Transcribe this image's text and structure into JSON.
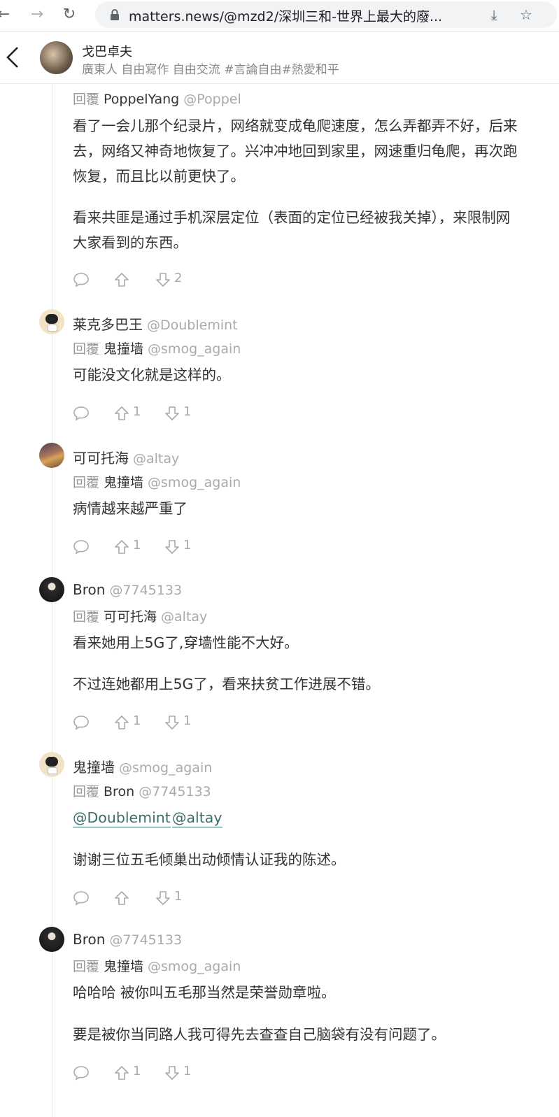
{
  "browser": {
    "url": "matters.news/@mzd2/深圳三和-世界上最大的廢...",
    "back_icon": "arrow-left",
    "forward_icon": "arrow-right",
    "reload_icon": "reload",
    "lock_icon": "lock",
    "download_icon": "download",
    "star_icon": "star"
  },
  "header": {
    "author_name": "戈巴卓夫",
    "author_bio": "廣東人 自由寫作 自由交流 #言論自由#熱愛和平"
  },
  "labels": {
    "reply_prefix": "回覆"
  },
  "comments": [
    {
      "reply_name": "PoppelYang",
      "reply_handle": "@Poppel",
      "lines": [
        "看了一会儿那个纪录片，网络就变成龟爬速度，怎么弄都弄不好，后来",
        "去，网络又神奇地恢复了。兴冲冲地回到家里，网速重归龟爬，再次跑",
        "恢复，而且比以前更快了。",
        "看来共匪是通过手机深层定位（表面的定位已经被我关掉），来限制网",
        "大家看到的东西。"
      ],
      "upvotes": "",
      "downvotes": "2"
    },
    {
      "name": "莱克多巴王",
      "handle": "@Doublemint",
      "reply_name": "鬼撞墙",
      "reply_handle": "@smog_again",
      "lines": [
        "可能没文化就是这样的。"
      ],
      "upvotes": "1",
      "downvotes": "1"
    },
    {
      "name": "可可托海",
      "handle": "@altay",
      "reply_name": "鬼撞墙",
      "reply_handle": "@smog_again",
      "lines": [
        "病情越来越严重了"
      ],
      "upvotes": "1",
      "downvotes": "1"
    },
    {
      "name": "Bron",
      "handle": "@7745133",
      "reply_name": "可可托海",
      "reply_handle": "@altay",
      "lines": [
        "看来她用上5G了,穿墙性能不大好。",
        "不过连她都用上5G了，看来扶贫工作进展不错。"
      ],
      "upvotes": "1",
      "downvotes": "1"
    },
    {
      "name": "鬼撞墙",
      "handle": "@smog_again",
      "reply_name": "Bron",
      "reply_handle": "@7745133",
      "mentions": [
        "@Doublemint",
        "@altay"
      ],
      "lines": [
        "谢谢三位五毛倾巢出动倾情认证我的陈述。"
      ],
      "upvotes": "",
      "downvotes": "1"
    },
    {
      "name": "Bron",
      "handle": "@7745133",
      "reply_name": "鬼撞墙",
      "reply_handle": "@smog_again",
      "lines": [
        "哈哈哈 被你叫五毛那当然是荣誉勋章啦。",
        "要是被你当同路人我可得先去查查自己脑袋有没有问题了。"
      ],
      "upvotes": "1",
      "downvotes": "1"
    }
  ]
}
